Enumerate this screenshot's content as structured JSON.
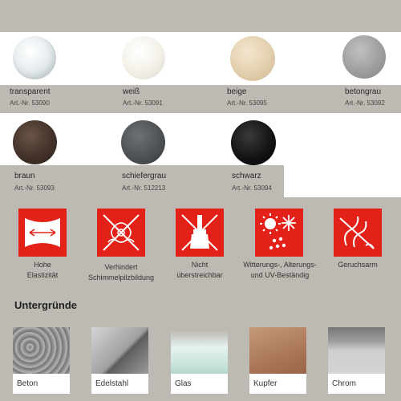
{
  "colors_row1": [
    {
      "name": "transparent",
      "art": "Art.-Nr. 53090",
      "swatch": "#dfe6e8"
    },
    {
      "name": "weiß",
      "art": "Art.-Nr. 53091",
      "swatch": "#f3f1e8"
    },
    {
      "name": "beige",
      "art": "Art.-Nr. 53095",
      "swatch": "#e6d4b6"
    },
    {
      "name": "betongrau",
      "art": "Art.-Nr. 53092",
      "swatch": "#9ea0a0"
    }
  ],
  "colors_row2": [
    {
      "name": "braun",
      "art": "Art.-Nr. 53093",
      "swatch": "#43332a"
    },
    {
      "name": "schiefergrau",
      "art": "Art.-Nr. 512213",
      "swatch": "#4e5255"
    },
    {
      "name": "schwarz",
      "art": "Art.-Nr. 53094",
      "swatch": "#111111"
    }
  ],
  "features": [
    {
      "label": "Hohe\nElastizität",
      "icon": "elasticity-arrows-icon"
    },
    {
      "label": "Verhindert\nSchimmelpilzbildung",
      "icon": "no-mould-icon"
    },
    {
      "label": "Nicht\nüberstreichbar",
      "icon": "no-paint-brush-icon"
    },
    {
      "label": "Witterungs-, Alterungs-\nund UV-Beständig",
      "icon": "weather-uv-icon"
    },
    {
      "label": "Geruchsarm",
      "icon": "low-odour-icon"
    }
  ],
  "substrates_heading": "Untergründe",
  "substrates": [
    {
      "label": "Beton",
      "texture": "concrete"
    },
    {
      "label": "Edelstahl",
      "texture": "steel"
    },
    {
      "label": "Glas",
      "texture": "glass"
    },
    {
      "label": "Kupfer",
      "texture": "copper"
    },
    {
      "label": "Chrom",
      "texture": "chrome"
    }
  ],
  "theme": {
    "background": "#bcbab2",
    "accent_red": "#e32119"
  }
}
